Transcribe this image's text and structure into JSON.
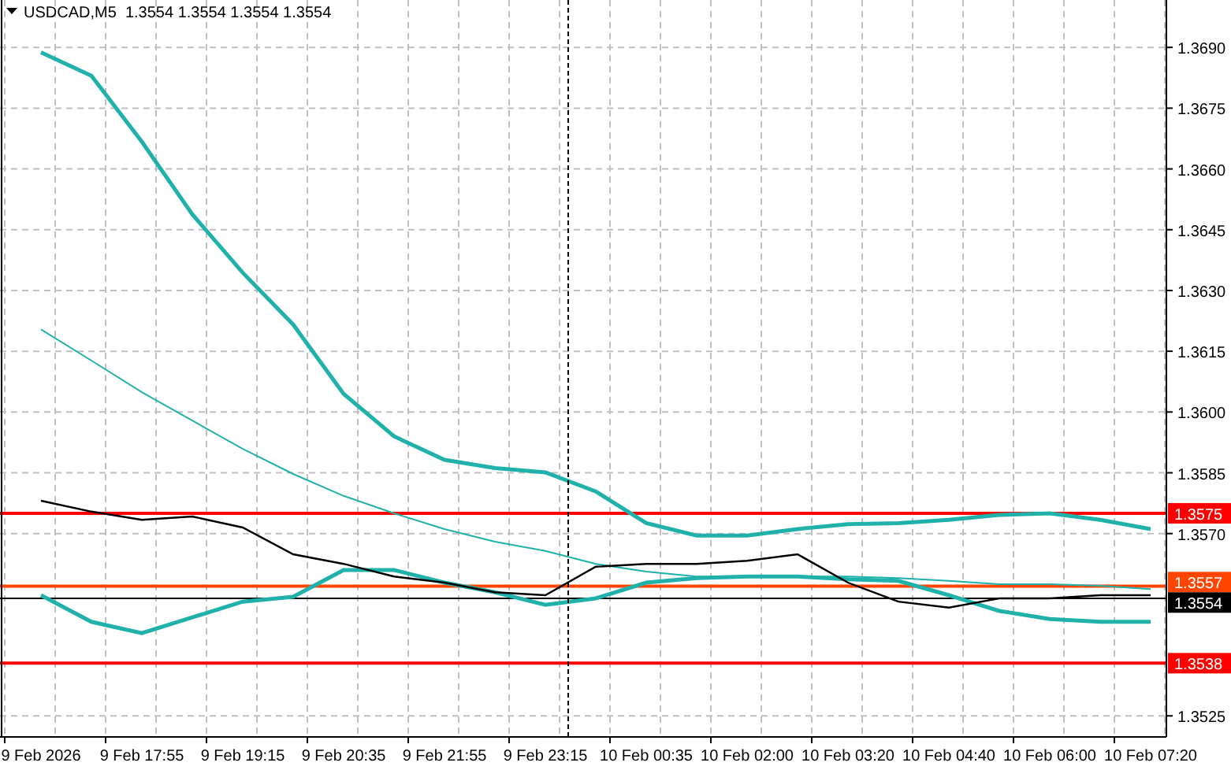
{
  "chart": {
    "title": "USDCAD,M5  1.3554 1.3554 1.3554 1.3554",
    "chart_data": {
      "type": "line",
      "grid": true,
      "categories": [
        "9 Feb 2026",
        null,
        "9 Feb 17:55",
        null,
        "9 Feb 19:15",
        null,
        "9 Feb 20:35",
        null,
        "9 Feb 21:55",
        null,
        "9 Feb 23:15",
        null,
        "10 Feb 00:35",
        null,
        "10 Feb 02:00",
        null,
        "10 Feb 03:20",
        null,
        "10 Feb 04:40",
        null,
        "10 Feb 06:00",
        null,
        "10 Feb 07:20"
      ],
      "ylim": [
        1.35198,
        1.37017
      ],
      "yticks": [
        {
          "value": 1.369,
          "label": "1.3690"
        },
        {
          "value": 1.3675,
          "label": "1.3675"
        },
        {
          "value": 1.366,
          "label": "1.3660"
        },
        {
          "value": 1.3645,
          "label": "1.3645"
        },
        {
          "value": 1.363,
          "label": "1.3630"
        },
        {
          "value": 1.3615,
          "label": "1.3615"
        },
        {
          "value": 1.36,
          "label": "1.3600"
        },
        {
          "value": 1.3585,
          "label": "1.3585"
        },
        {
          "value": 1.357,
          "label": "1.3570"
        },
        {
          "value": 1.3525,
          "label": "1.3525"
        }
      ],
      "series": [
        {
          "color": "#20b2aa",
          "values": [
            1.36888,
            1.3683,
            1.36667,
            1.36488,
            1.36344,
            1.36216,
            1.36045,
            1.3594,
            1.35882,
            1.35862,
            1.35851,
            1.35804,
            1.35726,
            1.35695,
            1.35695,
            1.35711,
            1.35723,
            1.35726,
            1.35734,
            1.35746,
            1.3575,
            1.35734,
            1.35711
          ]
        },
        {
          "color": "#20b2aa",
          "values": [
            1.36204,
            1.36127,
            1.36049,
            1.35979,
            1.35909,
            1.35847,
            1.35793,
            1.3575,
            1.35711,
            1.3568,
            1.35657,
            1.35625,
            1.35606,
            1.35594,
            1.35594,
            1.35594,
            1.35594,
            1.3559,
            1.35583,
            1.35575,
            1.35575,
            1.35571,
            1.35563
          ]
        },
        {
          "color": "#20b2aa",
          "values": [
            1.35548,
            1.35482,
            1.35454,
            1.35493,
            1.35532,
            1.35544,
            1.3561,
            1.3561,
            1.35579,
            1.35555,
            1.35524,
            1.3554,
            1.35579,
            1.3559,
            1.35594,
            1.35594,
            1.35587,
            1.35583,
            1.35548,
            1.35509,
            1.35489,
            1.35482,
            1.35482
          ]
        },
        {
          "color": "#000000",
          "values": [
            1.35781,
            1.35754,
            1.35734,
            1.35742,
            1.35715,
            1.35649,
            1.35625,
            1.35594,
            1.35579,
            1.35555,
            1.35548,
            1.35618,
            1.35625,
            1.35625,
            1.35633,
            1.35649,
            1.35579,
            1.35532,
            1.35517,
            1.3554,
            1.3554,
            1.35548,
            1.35548
          ]
        }
      ],
      "ref_lines": [
        {
          "axis": "y",
          "value": 1.3575,
          "label": "1.3575",
          "color": "#ff0000"
        },
        {
          "axis": "y",
          "value": 1.3557,
          "label": "1.3557",
          "color": "#ff4500"
        },
        {
          "axis": "y",
          "value": 1.3554,
          "label": "1.3554",
          "color": "#000000"
        },
        {
          "axis": "y",
          "value": 1.3538,
          "label": "1.3538",
          "color": "#ff0000"
        }
      ]
    }
  }
}
